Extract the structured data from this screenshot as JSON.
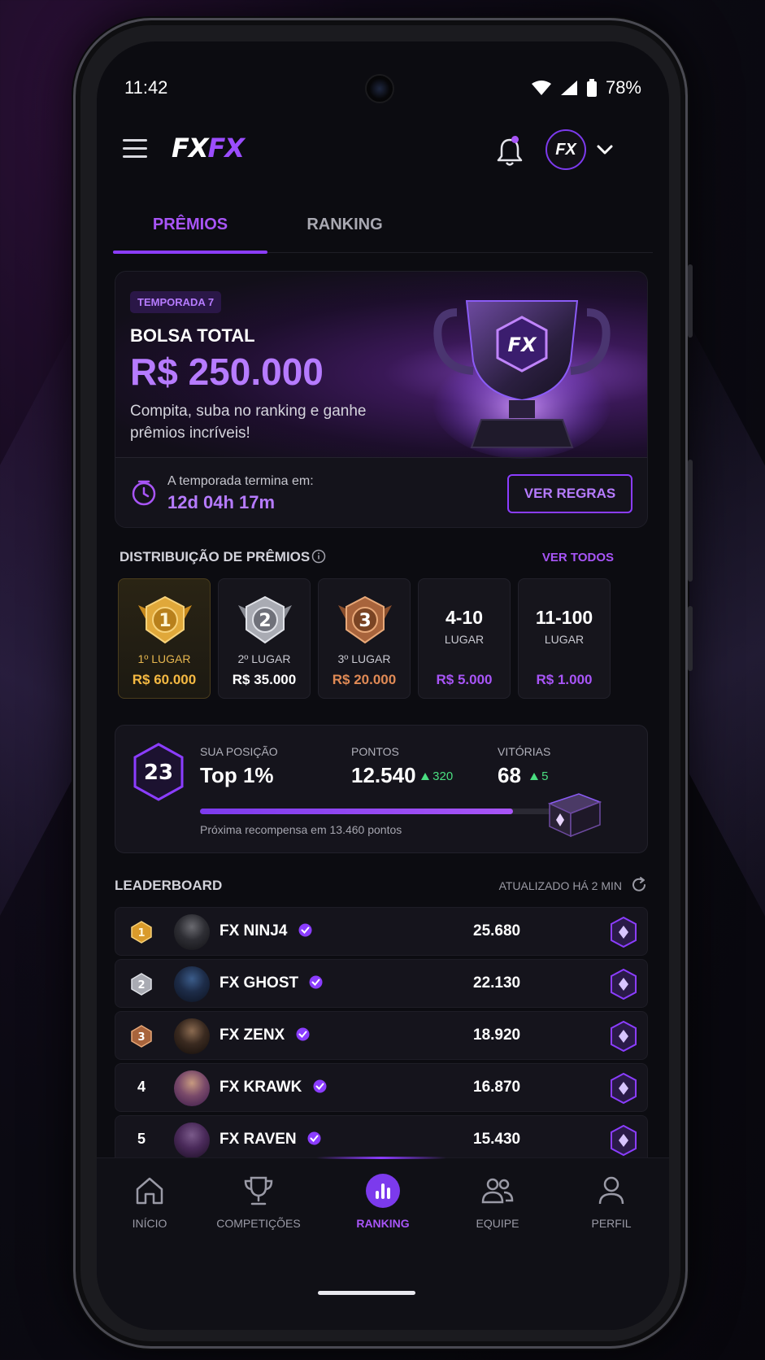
{
  "status_bar": {
    "time": "11:42",
    "battery": "78%"
  },
  "app": {
    "logo_part1": "FX",
    "logo_part2": "FX",
    "avatar_text": "FX"
  },
  "tabs": [
    {
      "label": "PRÊMIOS",
      "active": true
    },
    {
      "label": "RANKING",
      "active": false
    }
  ],
  "hero": {
    "season_badge": "TEMPORADA 7",
    "label": "BOLSA TOTAL",
    "amount": "R$ 250.000",
    "description": "Compita, suba no ranking e ganhe prêmios incríveis!",
    "ends_label": "A temporada termina em:",
    "ends_value": "12d 04h 17m",
    "rules_button": "VER REGRAS",
    "trophy_text": "FX"
  },
  "prize_distribution": {
    "title": "DISTRIBUIÇÃO DE PRÊMIOS",
    "see_all": "VER TODOS",
    "prizes": [
      {
        "medal": "1",
        "place": "1º LUGAR",
        "value": "R$ 60.000",
        "color": "#f5b942"
      },
      {
        "medal": "2",
        "place": "2º LUGAR",
        "value": "R$ 35.000",
        "color": "#ffffff"
      },
      {
        "medal": "3",
        "place": "3º LUGAR",
        "value": "R$ 20.000",
        "color": "#e08a55"
      },
      {
        "range": "4-10",
        "place": "LUGAR",
        "value": "R$ 5.000",
        "color": "#a855f7"
      },
      {
        "range": "11-100",
        "place": "LUGAR",
        "value": "R$ 1.000",
        "color": "#a855f7"
      }
    ]
  },
  "position": {
    "rank": "23",
    "position_label": "SUA POSIÇÃO",
    "position_value": "Top 1%",
    "points_label": "PONTOS",
    "points_value": "12.540",
    "points_delta": "320",
    "wins_label": "VITÓRIAS",
    "wins_value": "68",
    "wins_delta": "5",
    "progress": 0.82,
    "next_reward": "Próxima recompensa em 13.460 pontos"
  },
  "leaderboard": {
    "title": "LEADERBOARD",
    "updated": "ATUALIZADO HÁ 2 MIN",
    "rows": [
      {
        "rank": "1",
        "name": "FX  NINJ4",
        "score": "25.680"
      },
      {
        "rank": "2",
        "name": "FX  GHOST",
        "score": "22.130"
      },
      {
        "rank": "3",
        "name": "FX  ZENX",
        "score": "18.920"
      },
      {
        "rank": "4",
        "name": "FX  KRAWK",
        "score": "16.870"
      },
      {
        "rank": "5",
        "name": "FX  RAVEN",
        "score": "15.430"
      }
    ]
  },
  "bottom_nav": [
    {
      "label": "INÍCIO",
      "icon": "home-icon"
    },
    {
      "label": "COMPETIÇÕES",
      "icon": "trophy-icon"
    },
    {
      "label": "RANKING",
      "icon": "bar-chart-icon",
      "active": true
    },
    {
      "label": "EQUIPE",
      "icon": "team-icon"
    },
    {
      "label": "PERFIL",
      "icon": "user-icon"
    }
  ],
  "colors": {
    "accent": "#a855f7",
    "accent_dark": "#7c3aed",
    "positive": "#4ade80",
    "gold": "#f5b942",
    "bronze": "#e08a55"
  }
}
